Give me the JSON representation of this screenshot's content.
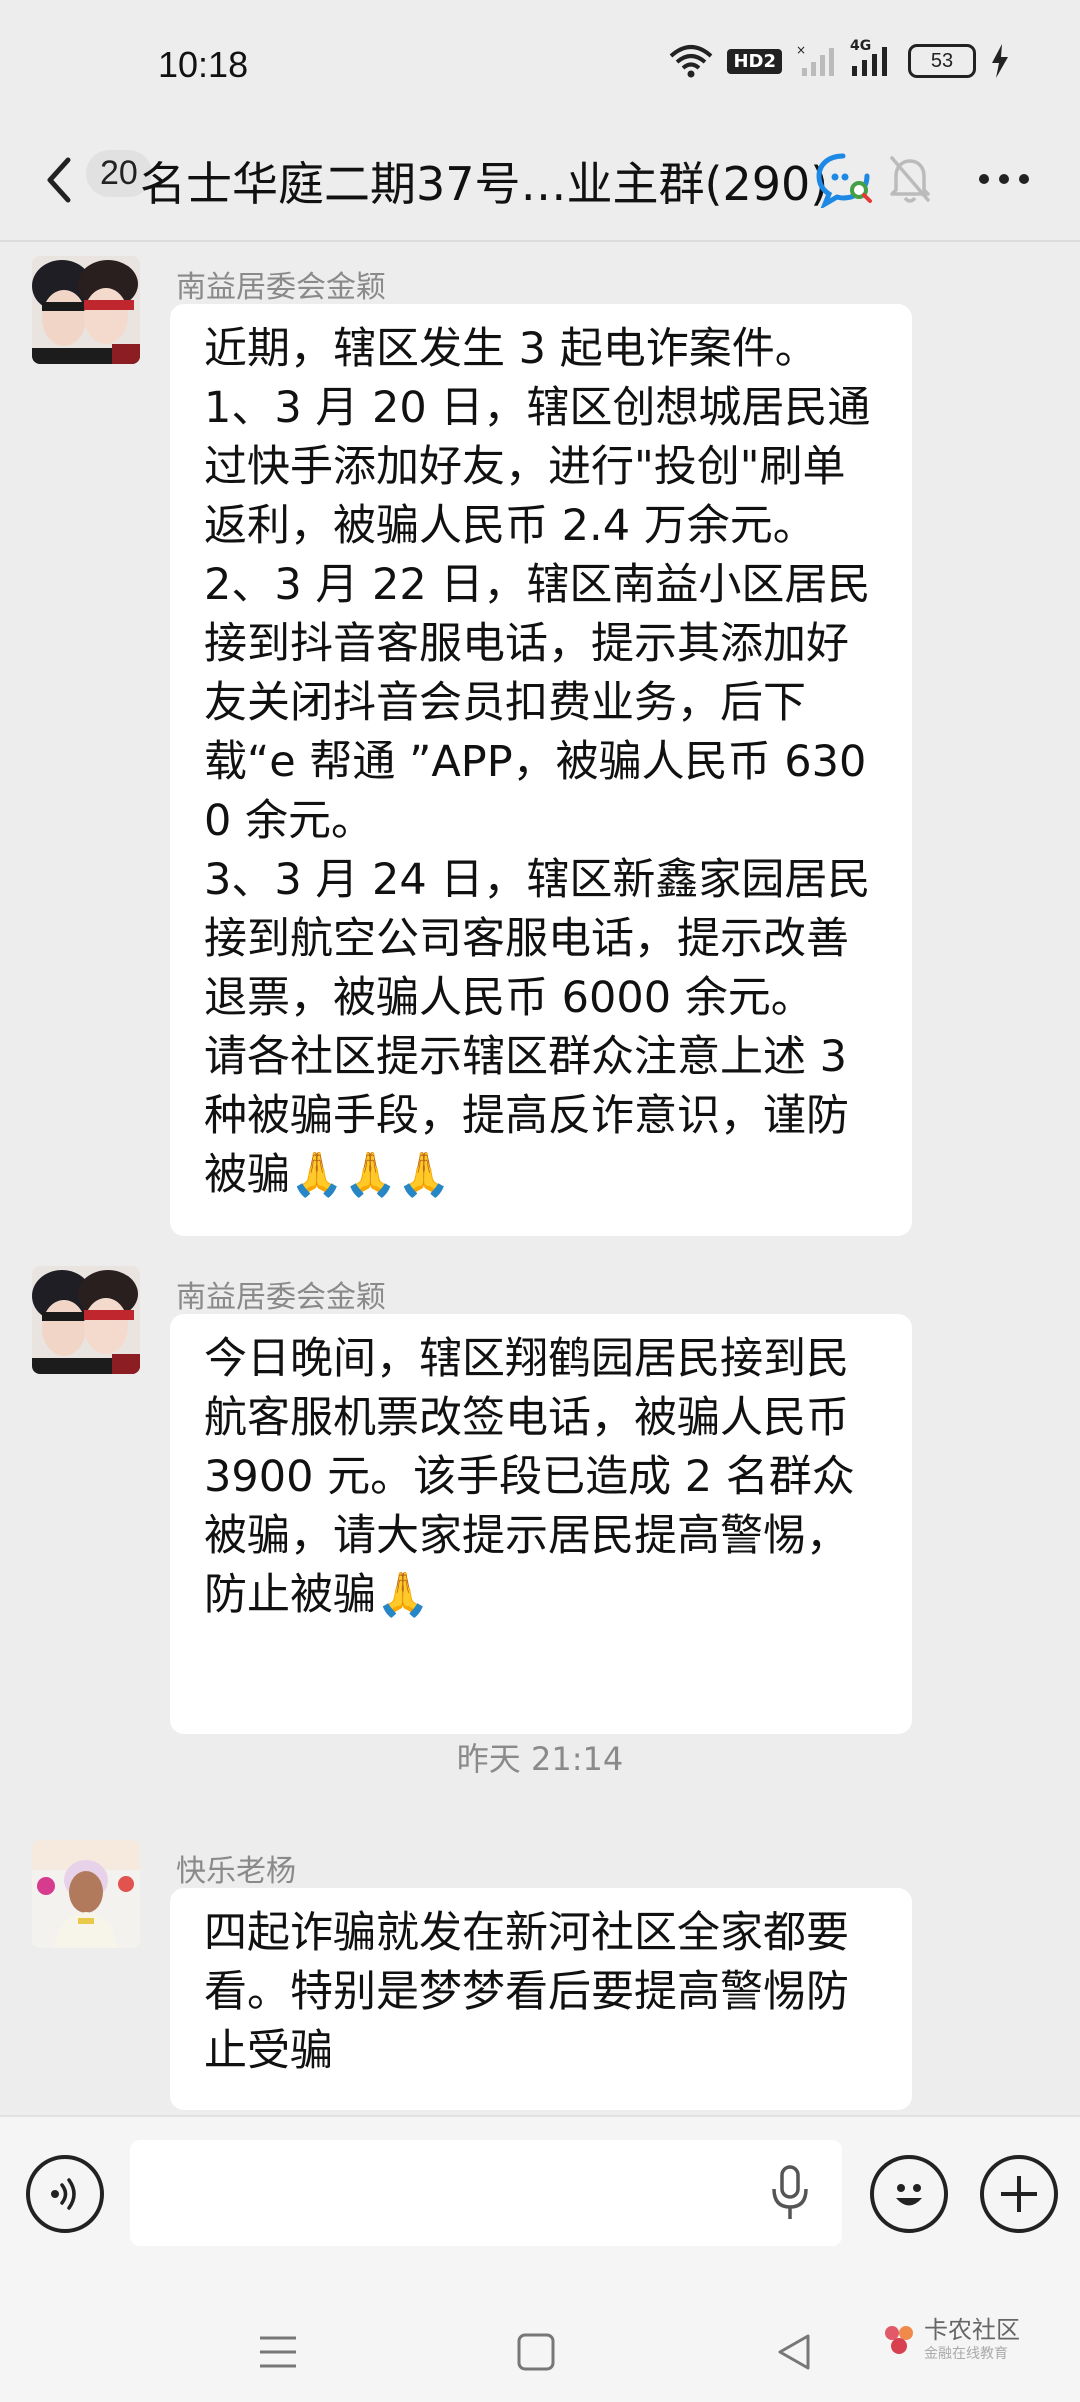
{
  "status_bar": {
    "time": "10:18",
    "network_badge": "HD2",
    "network_type": "4G",
    "battery": "53"
  },
  "header": {
    "unread_count": "20",
    "title": "名士华庭二期37号…业主群(290)"
  },
  "messages": [
    {
      "sender": "南益居委会金颖",
      "text": "近期，辖区发生 3 起电诈案件。\n1、3 月 20 日，辖区创想城居民通过快手添加好友，进行\"投创\"刷单返利，被骗人民币 2.4 万余元。\n2、3 月 22 日，辖区南益小区居民接到抖音客服电话，提示其添加好友关闭抖音会员扣费业务，后下载“e 帮通 ”APP，被骗人民币 6300 余元。\n3、3 月 24 日，辖区新鑫家园居民接到航空公司客服电话，提示改善退票，被骗人民币 6000 余元。\n请各社区提示辖区群众注意上述 3 种被骗手段，提高反诈意识，谨防被骗🙏🙏🙏"
    },
    {
      "sender": "南益居委会金颖",
      "text": "今日晚间，辖区翔鹤园居民接到民航客服机票改签电话，被骗人民币 3900 元。该手段已造成 2 名群众被骗，请大家提示居民提高警惕，防止被骗🙏"
    },
    {
      "sender": "快乐老杨",
      "text": "四起诈骗就发在新河社区全家都要看。特别是梦梦看后要提高警惕防止受骗"
    }
  ],
  "timestamp": "昨天 21:14",
  "input": {
    "value": ""
  },
  "watermark": {
    "name": "卡农社区",
    "tagline": "金融在线教育"
  },
  "icons": [
    "wifi-icon",
    "signal-icon",
    "battery-icon",
    "charging-icon",
    "back-icon",
    "chat-search-icon",
    "mute-bell-icon",
    "more-icon",
    "voice-icon",
    "mic-icon",
    "emoji-icon",
    "plus-icon",
    "nav-menu-icon",
    "nav-home-icon",
    "nav-back-icon"
  ]
}
